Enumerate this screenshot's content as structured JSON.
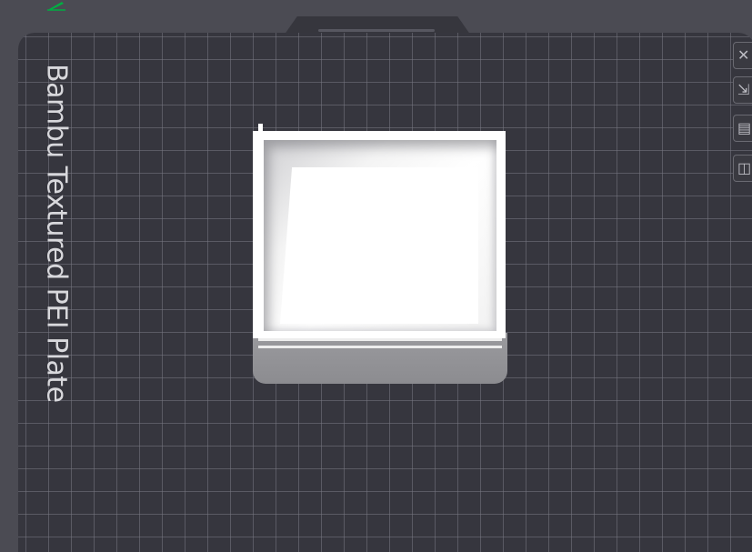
{
  "plate": {
    "label": "Bambu Textured PEI Plate"
  },
  "toolbar": {
    "buttons": [
      {
        "icon": "close-icon",
        "glyph": "✕"
      },
      {
        "icon": "arrange-icon",
        "glyph": "⇲"
      },
      {
        "icon": "layers-icon",
        "glyph": "▤"
      },
      {
        "icon": "lock-icon",
        "glyph": "◫"
      }
    ]
  },
  "colors": {
    "plate": "#36363e",
    "grid": "#78787f",
    "background": "#4b4b53",
    "model": "#ffffff",
    "accent": "#00ae42"
  }
}
